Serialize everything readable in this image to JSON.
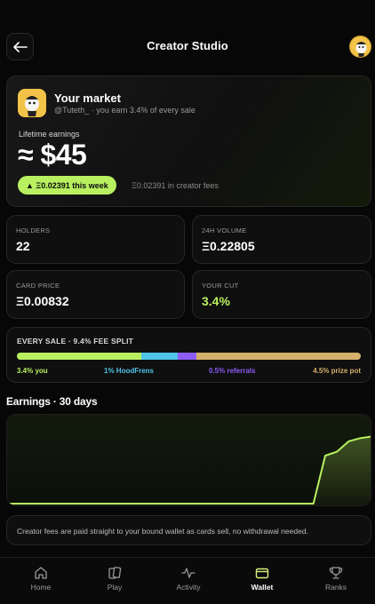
{
  "header": {
    "title": "Creator Studio",
    "back_icon": "arrow-left-icon"
  },
  "market": {
    "title": "Your market",
    "subtitle": "@Tuteth_ · you earn 3.4% of every sale",
    "lifetime_label": "Lifetime earnings",
    "lifetime_value": "≈ $45",
    "week_pill": "▲ Ξ0.02391 this week",
    "fees_text": "Ξ0.02391 in creator fees"
  },
  "stats": {
    "holders_label": "HOLDERS",
    "holders_value": "22",
    "volume_label": "24H VOLUME",
    "volume_value": "Ξ0.22805",
    "price_label": "CARD PRICE",
    "price_value": "Ξ0.00832",
    "cut_label": "YOUR CUT",
    "cut_value": "3.4%"
  },
  "fee_split": {
    "title": "EVERY SALE · 9.4% FEE SPLIT",
    "segments": [
      {
        "label": "3.4% you",
        "share": 3.4,
        "color": "#b8f060"
      },
      {
        "label": "1% HoodFrens",
        "share": 1.0,
        "color": "#4fc3e8"
      },
      {
        "label": "0.5% referrals",
        "share": 0.5,
        "color": "#8b5cf6"
      },
      {
        "label": "4.5% prize pot",
        "share": 4.5,
        "color": "#d4b06a"
      }
    ]
  },
  "earnings": {
    "title": "Earnings · 30 days",
    "points": [
      0,
      0,
      0,
      0,
      0,
      0,
      0,
      0,
      0,
      0,
      0,
      0,
      0,
      0,
      0,
      0,
      0,
      0,
      0,
      0,
      0,
      0,
      0,
      0,
      0,
      0,
      0,
      0.6,
      0.65,
      0.78,
      0.82,
      0.84
    ]
  },
  "info": {
    "text": "Creator fees are paid straight to your bound wallet as cards sell, no withdrawal needed."
  },
  "tabs": [
    {
      "label": "Home",
      "icon": "home-icon",
      "active": false
    },
    {
      "label": "Play",
      "icon": "cards-icon",
      "active": false
    },
    {
      "label": "Activity",
      "icon": "pulse-icon",
      "active": false
    },
    {
      "label": "Wallet",
      "icon": "wallet-icon",
      "active": true
    },
    {
      "label": "Ranks",
      "icon": "trophy-icon",
      "active": false
    }
  ],
  "colors": {
    "accent": "#b8f060",
    "background": "#070707",
    "card": "#0f0f0f"
  }
}
